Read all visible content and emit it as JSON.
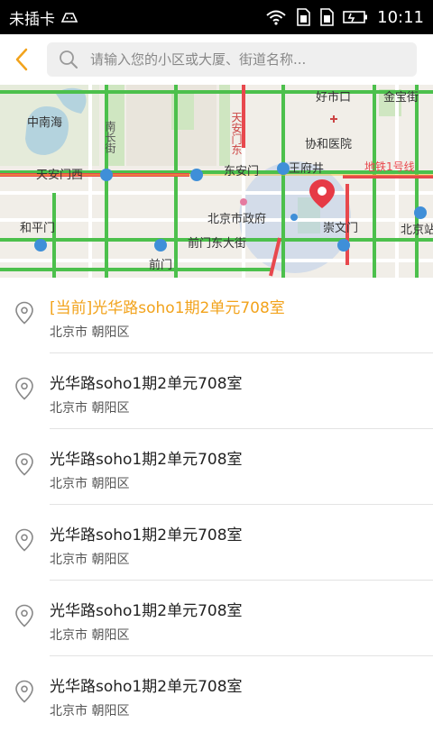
{
  "status_bar": {
    "carrier": "未插卡",
    "time": "10:11"
  },
  "header": {
    "search_placeholder": "请输入您的小区或大厦、街道名称..."
  },
  "map": {
    "labels": {
      "zhongnanhai": "中南海",
      "nanchangjie": "南长街",
      "tiananmen_west": "天安门西",
      "tiananmen_east": "天安门东",
      "wangfujing": "王府井",
      "donganmen": "东安门",
      "xiehe": "协和医院",
      "haoshikou": "好市口",
      "jinbaojie": "金宝街",
      "beijing_gov": "北京市政府",
      "chongwenmen": "崇文门",
      "qianmen_east": "前门东大街",
      "qianmen": "前门",
      "heping": "和平门",
      "beijing_station": "北京站",
      "line1": "地铁1号线"
    },
    "colors": {
      "road_green": "#4cc04c",
      "road_red": "#e8484d",
      "marker_red": "#e63a46",
      "radius_fill": "#b9cde9"
    }
  },
  "list": {
    "current_prefix": "[当前]",
    "items": [
      {
        "title": "光华路soho1期2单元708室",
        "subtitle": "北京市  朝阳区",
        "current": true
      },
      {
        "title": "光华路soho1期2单元708室",
        "subtitle": "北京市  朝阳区",
        "current": false
      },
      {
        "title": "光华路soho1期2单元708室",
        "subtitle": "北京市  朝阳区",
        "current": false
      },
      {
        "title": "光华路soho1期2单元708室",
        "subtitle": "北京市  朝阳区",
        "current": false
      },
      {
        "title": "光华路soho1期2单元708室",
        "subtitle": "北京市  朝阳区",
        "current": false
      },
      {
        "title": "光华路soho1期2单元708室",
        "subtitle": "北京市  朝阳区",
        "current": false
      }
    ]
  },
  "theme": {
    "accent": "#f2a31c"
  }
}
